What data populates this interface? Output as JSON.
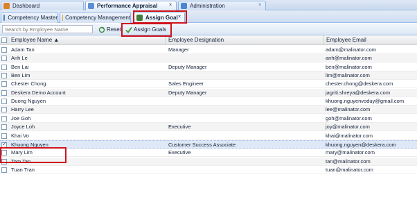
{
  "top_tabs": [
    {
      "label": "Dashboard",
      "icon": "dashboard-icon",
      "close": ""
    },
    {
      "label": "Performance Appraisal",
      "icon": "performance-icon",
      "close": "×"
    },
    {
      "label": "Administration",
      "icon": "administration-icon",
      "close": "×"
    }
  ],
  "sub_tabs": [
    {
      "label": "Competency Master",
      "icon": "competency-master-icon",
      "close": ""
    },
    {
      "label": "Competency Management",
      "icon": "competency-management-icon",
      "close": ""
    },
    {
      "label": "Assign Goal",
      "icon": "assign-goal-icon",
      "close": "×"
    }
  ],
  "toolbar": {
    "search_placeholder": "Search by Employee Name",
    "reset_label": "Reset",
    "assign_goals_label": "Assign Goals"
  },
  "grid": {
    "headers": [
      "Employee Name ▲",
      "Employee Designation",
      "Employee Email"
    ],
    "rows": [
      {
        "name": "Adam Tan",
        "designation": "Manager",
        "email": "adam@malinator.com",
        "checked": false
      },
      {
        "name": "Anh Le",
        "designation": "",
        "email": "anh@malinator.com",
        "checked": false
      },
      {
        "name": "Ben Lai",
        "designation": "Deputy Manager",
        "email": "ben@malinator.com",
        "checked": false
      },
      {
        "name": "Ben Lim",
        "designation": "",
        "email": "lim@malinator.com",
        "checked": false
      },
      {
        "name": "Chester Chong",
        "designation": "Sales Engineer",
        "email": "chester.chong@deskera.com",
        "checked": false
      },
      {
        "name": "Deskera Demo Account",
        "designation": "Deputy Manager",
        "email": "jagriti.shreya@deskera.com",
        "checked": false
      },
      {
        "name": "Duong Nguyen",
        "designation": "",
        "email": "khuong.nguyenvoduy@gmail.com",
        "checked": false
      },
      {
        "name": "Harry Lee",
        "designation": "",
        "email": "lee@malinator.com",
        "checked": false
      },
      {
        "name": "Joe Goh",
        "designation": "",
        "email": "goh@malinator.com",
        "checked": false
      },
      {
        "name": "Joyce Loh",
        "designation": "Executive",
        "email": "joy@malinator.com",
        "checked": false
      },
      {
        "name": "Khai Vo",
        "designation": "",
        "email": "khai@malinator.com",
        "checked": false
      },
      {
        "name": "Khuong Nguyen",
        "designation": "Customer Success Associate",
        "email": "khuong.nguyen@deskera.com",
        "checked": true
      },
      {
        "name": "Mary Lim",
        "designation": "Executive",
        "email": "mary@malinator.com",
        "checked": false
      },
      {
        "name": "Tom Tan",
        "designation": "",
        "email": "tan@malinator.com",
        "checked": false
      },
      {
        "name": "Tuan Tran",
        "designation": "",
        "email": "tuan@malinator.com",
        "checked": false
      }
    ]
  },
  "colors": {
    "highlight": "#d0121b",
    "selected_row": "#dfe8f6",
    "accent": "#99bbe8"
  }
}
